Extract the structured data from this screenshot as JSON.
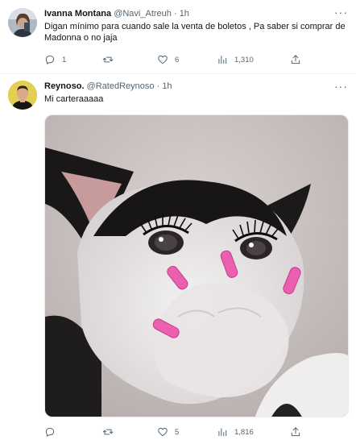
{
  "tweets": [
    {
      "author_name": "Ivanna Montana",
      "handle": "@Navi_Atreuh",
      "separator": "·",
      "time": "1h",
      "text": "Digan mínimo para cuando sale la venta de boletos , Pa saber si comprar de Madonna o no jaja",
      "more": "···",
      "reply_count": "1",
      "retweet_count": "",
      "like_count": "6",
      "view_count": "1,310"
    },
    {
      "author_name": "Reynoso.",
      "handle": "@RatedReynoso",
      "separator": "·",
      "time": "1h",
      "text": "Mi carteraaaaa",
      "more": "···",
      "reply_count": "",
      "retweet_count": "",
      "like_count": "5",
      "view_count": "1,816"
    }
  ],
  "icons": {
    "reply": "reply-icon",
    "retweet": "retweet-icon",
    "like": "heart-icon",
    "views": "views-icon",
    "share": "share-icon"
  },
  "colors": {
    "text_primary": "#0f1419",
    "text_secondary": "#536471",
    "divider": "#eff3f4",
    "nail_pink": "#ec5fae"
  }
}
